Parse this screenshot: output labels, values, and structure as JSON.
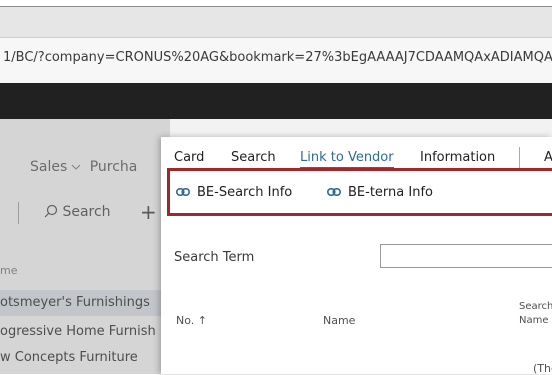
{
  "browser": {
    "url": "1/BC/?company=CRONUS%20AG&bookmark=27%3bEgAAAAJ7CDAAMQAxADIAMQA"
  },
  "background": {
    "nav": {
      "sales": "Sales",
      "purchasing": "Purcha"
    },
    "toolbar": {
      "search_label": "Search",
      "plus_label": "+"
    },
    "list": {
      "column_header": "me",
      "rows": [
        "otsmeyer's Furnishings",
        "ogressive Home Furnish",
        "w Concepts Furniture"
      ]
    }
  },
  "dialog": {
    "tabs": [
      "Card",
      "Search",
      "Link to Vendor",
      "Information",
      "A"
    ],
    "active_tab": "Link to Vendor",
    "actions": [
      {
        "label": "BE-Search Info",
        "icon": "link-icon"
      },
      {
        "label": "BE-terna Info",
        "icon": "link-icon"
      }
    ],
    "search_term_label": "Search Term",
    "search_term_value": "",
    "columns": {
      "no": "No. ↑",
      "name": "Name",
      "search_name_line1": "Search",
      "search_name_line2": "Name"
    },
    "empty_text": "(The"
  },
  "colors": {
    "accent": "#2f6c8f",
    "highlight_border": "#a0282a",
    "app_bar": "#212121"
  }
}
